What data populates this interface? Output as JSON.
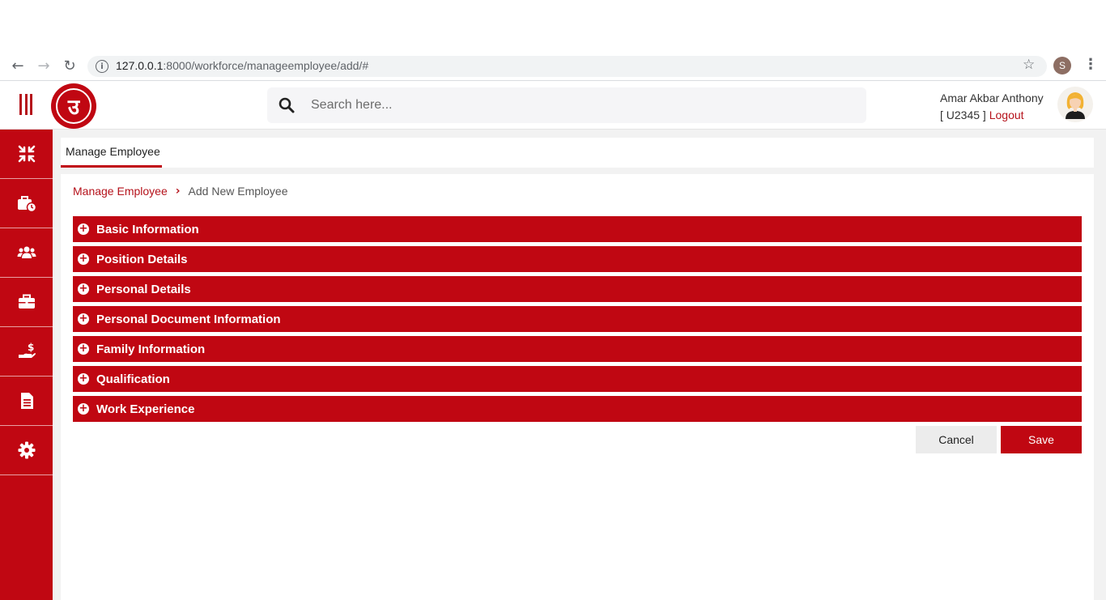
{
  "browser": {
    "url_host": "127.0.0.1",
    "url_path": ":8000/workforce/manageemployee/add/#",
    "profile_initial": "S",
    "back_icon": "arrow-left-icon",
    "forward_icon": "arrow-right-icon",
    "reload_icon": "reload-icon",
    "bookmark_icon": "star-icon",
    "menu_icon": "kebab-icon"
  },
  "header": {
    "search_placeholder": "Search here...",
    "user_name": "Amar Akbar Anthony",
    "user_id": "[ U2345 ]",
    "logout_label": "Logout",
    "logo_glyph": "उ"
  },
  "sidebar": {
    "items": [
      {
        "icon": "compress-arrows-icon"
      },
      {
        "icon": "briefcase-clock-icon"
      },
      {
        "icon": "users-icon"
      },
      {
        "icon": "briefcase-icon"
      },
      {
        "icon": "hand-dollar-icon"
      },
      {
        "icon": "document-icon"
      },
      {
        "icon": "gear-icon"
      }
    ]
  },
  "tabs": [
    {
      "label": "Manage Employee",
      "active": true
    }
  ],
  "breadcrumb": {
    "parent": "Manage Employee",
    "current": "Add New Employee"
  },
  "sections": [
    {
      "label": "Basic Information"
    },
    {
      "label": "Position Details"
    },
    {
      "label": "Personal Details"
    },
    {
      "label": "Personal Document Information"
    },
    {
      "label": "Family Information"
    },
    {
      "label": "Qualification"
    },
    {
      "label": "Work Experience"
    }
  ],
  "actions": {
    "cancel_label": "Cancel",
    "save_label": "Save"
  },
  "colors": {
    "brand": "#c00712",
    "cancel_bg": "#ececec"
  }
}
